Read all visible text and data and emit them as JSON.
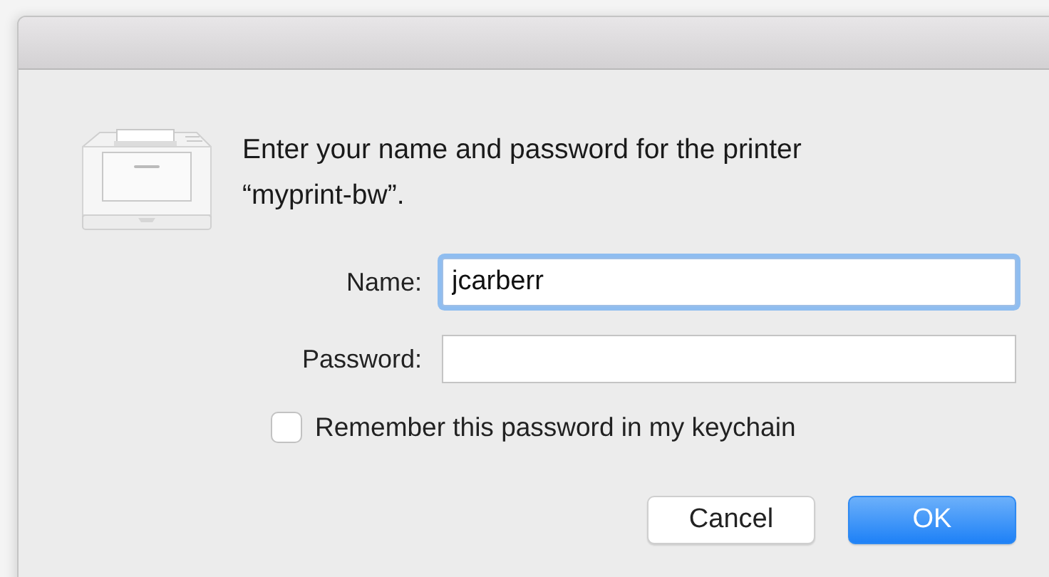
{
  "dialog": {
    "message": "Enter your name and password for the printer “myprint-bw”.",
    "fields": [
      {
        "label": "Name:",
        "value": "jcarberr",
        "focused": true
      },
      {
        "label": "Password:",
        "focused": false
      }
    ],
    "remember": {
      "label": "Remember this password in my keychain",
      "checked": false
    },
    "buttons": [
      {
        "label": "Cancel",
        "default": false
      },
      {
        "label": "OK",
        "default": true
      }
    ]
  }
}
